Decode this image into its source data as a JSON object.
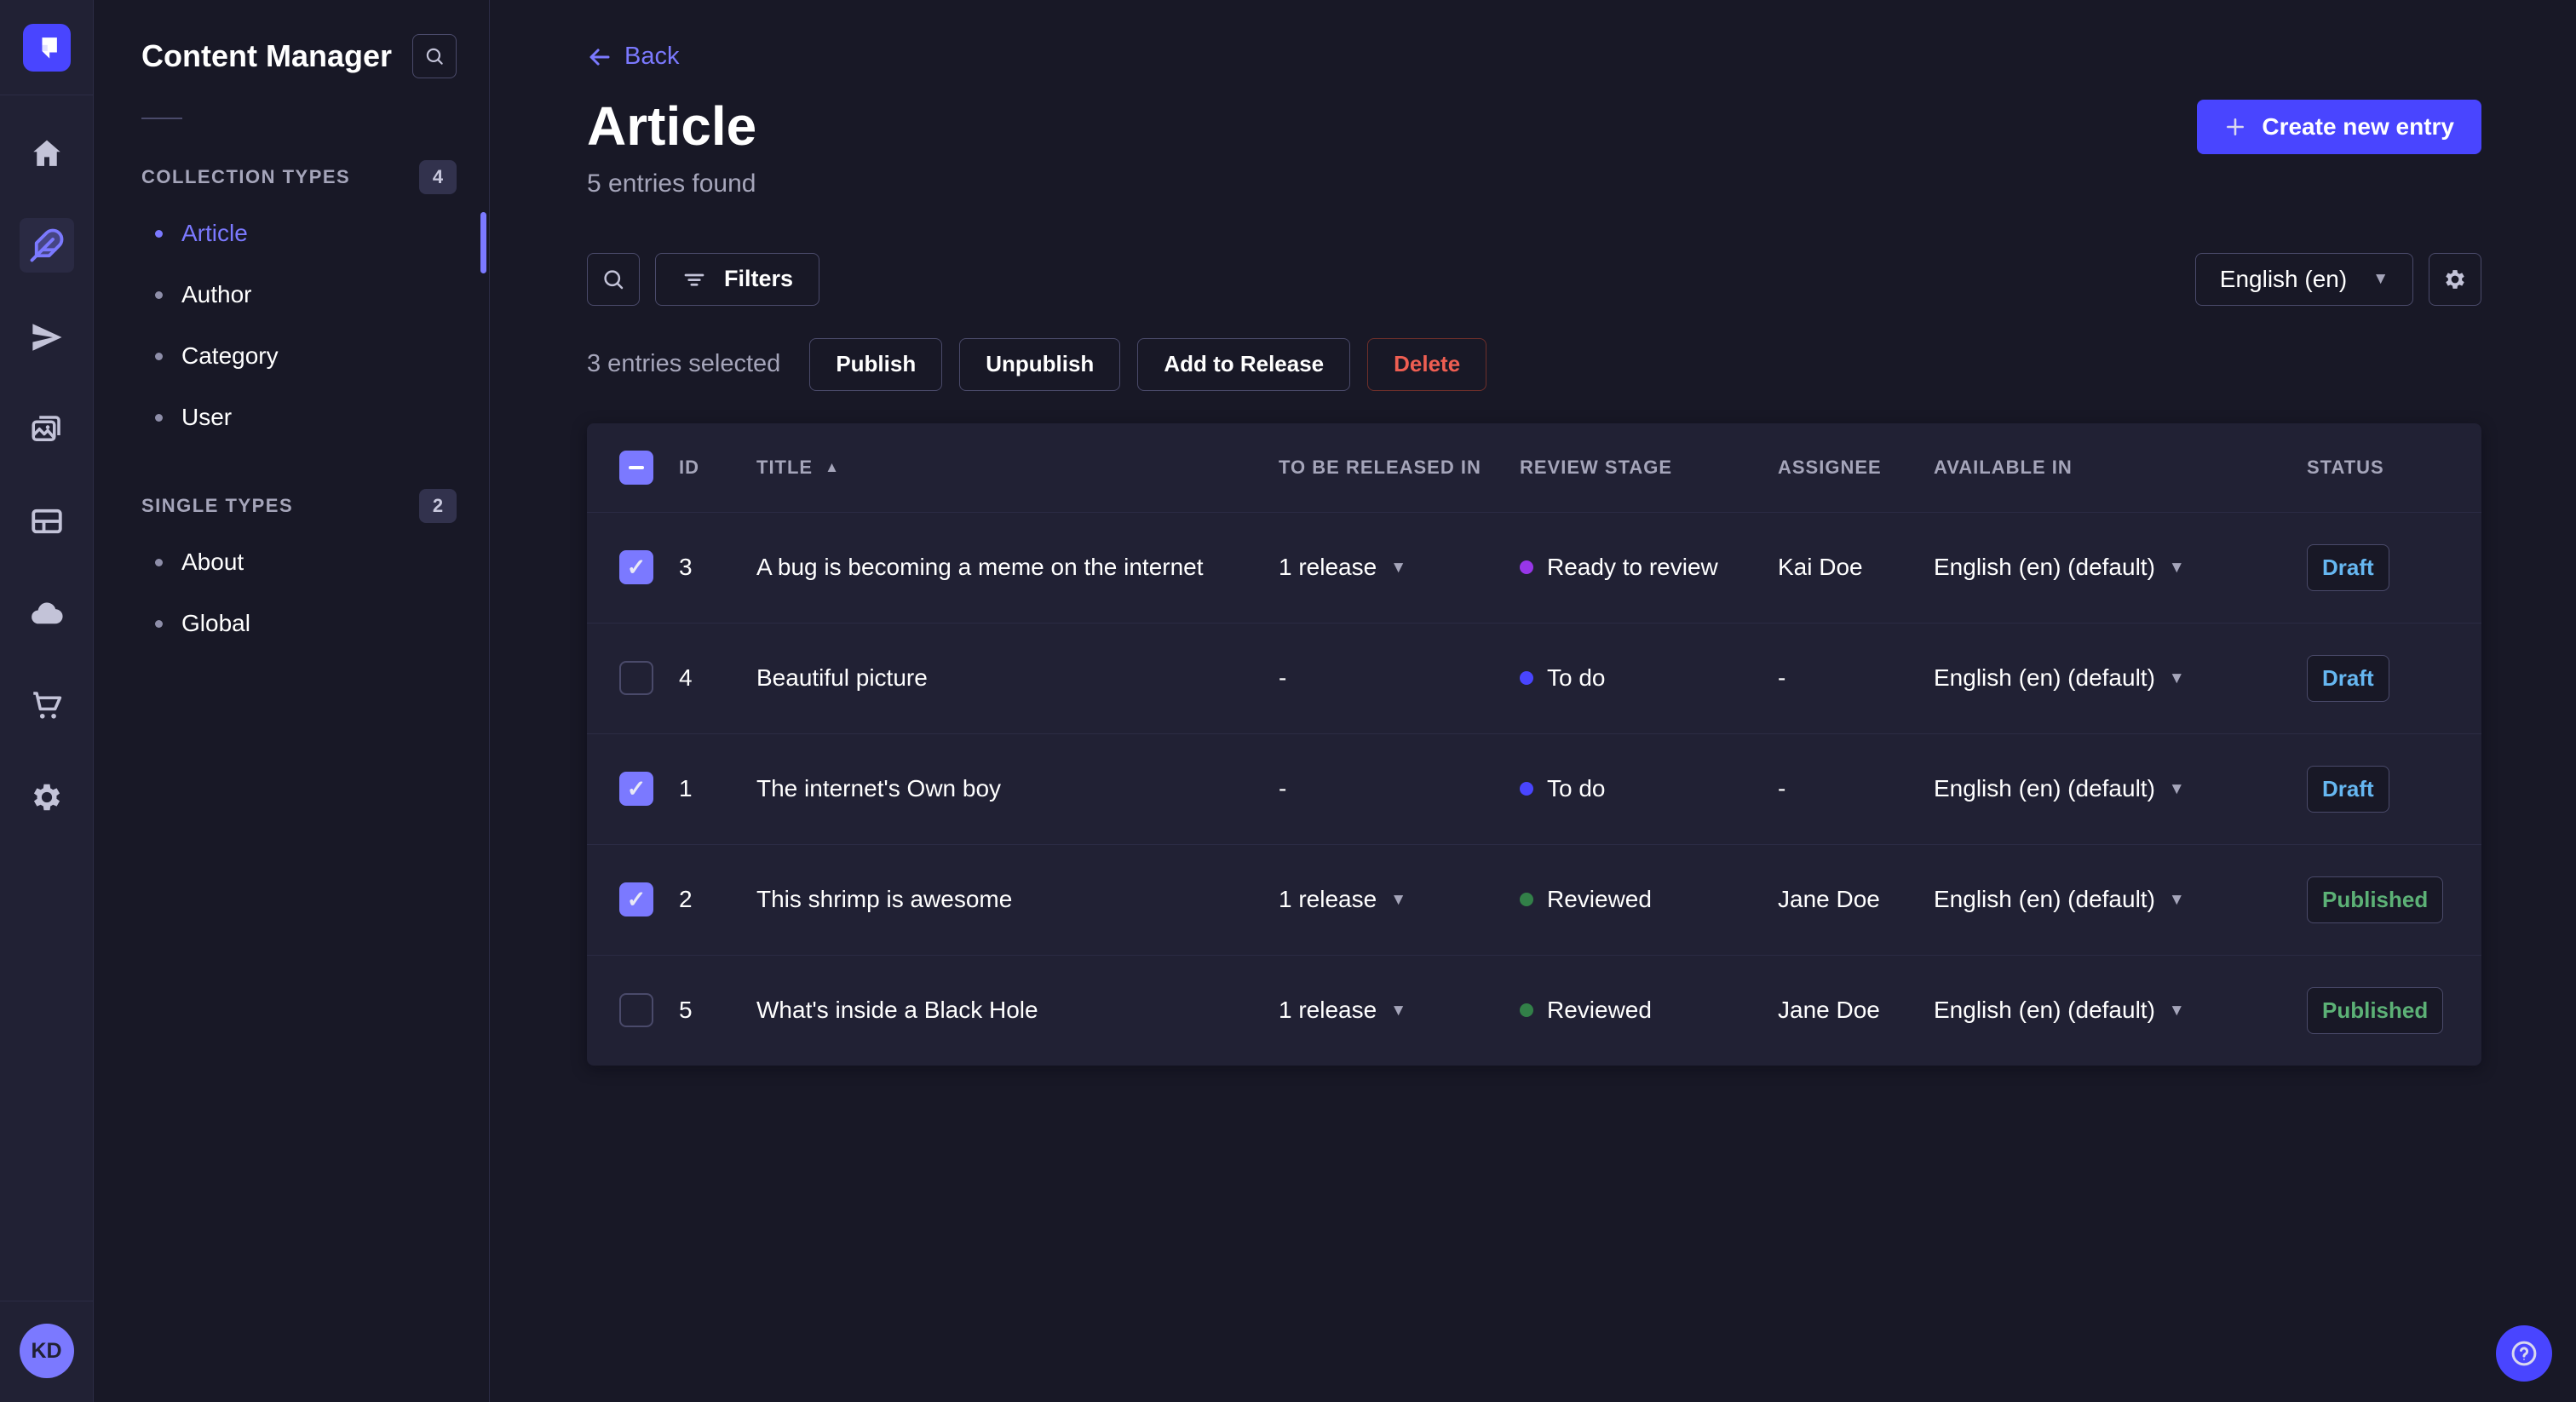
{
  "colors": {
    "accent": "#4945ff",
    "accent_light": "#7b79ff",
    "page_bg": "#181826",
    "panel_bg": "#212134",
    "border": "#32324d",
    "text_muted": "#a5a5ba",
    "danger": "#ee5e52",
    "draft_text": "#66b7f1",
    "published_text": "#5cb176",
    "stage_todo": "#4945ff",
    "stage_ready_to_review": "#9736e8",
    "stage_reviewed": "#328048"
  },
  "rail": {
    "icons": [
      "strapi-logo-icon",
      "home-icon",
      "content-manager-feather-icon",
      "releases-paper-plane-icon",
      "media-library-icon",
      "content-type-builder-icon",
      "cloud-icon",
      "marketplace-cart-icon",
      "settings-gear-icon"
    ],
    "active_item": "content-manager",
    "avatar_initials": "KD"
  },
  "sidebar": {
    "title": "Content Manager",
    "sections": [
      {
        "label": "COLLECTION TYPES",
        "count": "4",
        "items": [
          {
            "label": "Article",
            "active": true
          },
          {
            "label": "Author",
            "active": false
          },
          {
            "label": "Category",
            "active": false
          },
          {
            "label": "User",
            "active": false
          }
        ]
      },
      {
        "label": "SINGLE TYPES",
        "count": "2",
        "items": [
          {
            "label": "About",
            "active": false
          },
          {
            "label": "Global",
            "active": false
          }
        ]
      }
    ]
  },
  "header": {
    "back_label": "Back",
    "title": "Article",
    "subtitle": "5 entries found",
    "create_label": "Create new entry"
  },
  "toolbar": {
    "filters_label": "Filters",
    "locale_value": "English (en)"
  },
  "selection": {
    "summary": "3 entries selected",
    "publish_label": "Publish",
    "unpublish_label": "Unpublish",
    "add_to_release_label": "Add to Release",
    "delete_label": "Delete"
  },
  "table": {
    "select_all_state": "indeterminate",
    "sort": {
      "column": "TITLE",
      "direction": "ascending"
    },
    "headers": {
      "id": "ID",
      "title": "TITLE",
      "release": "TO BE RELEASED IN",
      "review_stage": "REVIEW STAGE",
      "assignee": "ASSIGNEE",
      "available_in": "AVAILABLE IN",
      "status": "STATUS"
    },
    "rows": [
      {
        "checked": true,
        "id": "3",
        "title": "A bug is becoming a meme on the internet",
        "release": "1 release",
        "release_caret": true,
        "stage": "Ready to review",
        "stage_color": "#9736e8",
        "assignee": "Kai Doe",
        "available": "English (en) (default)",
        "status": "Draft",
        "status_variant": "draft"
      },
      {
        "checked": false,
        "id": "4",
        "title": "Beautiful picture",
        "release": "-",
        "release_caret": false,
        "stage": "To do",
        "stage_color": "#4945ff",
        "assignee": "-",
        "available": "English (en) (default)",
        "status": "Draft",
        "status_variant": "draft"
      },
      {
        "checked": true,
        "id": "1",
        "title": "The internet's Own boy",
        "release": "-",
        "release_caret": false,
        "stage": "To do",
        "stage_color": "#4945ff",
        "assignee": "-",
        "available": "English (en) (default)",
        "status": "Draft",
        "status_variant": "draft"
      },
      {
        "checked": true,
        "id": "2",
        "title": "This shrimp is awesome",
        "release": "1 release",
        "release_caret": true,
        "stage": "Reviewed",
        "stage_color": "#328048",
        "assignee": "Jane Doe",
        "available": "English (en) (default)",
        "status": "Published",
        "status_variant": "published"
      },
      {
        "checked": false,
        "id": "5",
        "title": "What's inside a Black Hole",
        "release": "1 release",
        "release_caret": true,
        "stage": "Reviewed",
        "stage_color": "#328048",
        "assignee": "Jane Doe",
        "available": "English (en) (default)",
        "status": "Published",
        "status_variant": "published"
      }
    ]
  }
}
